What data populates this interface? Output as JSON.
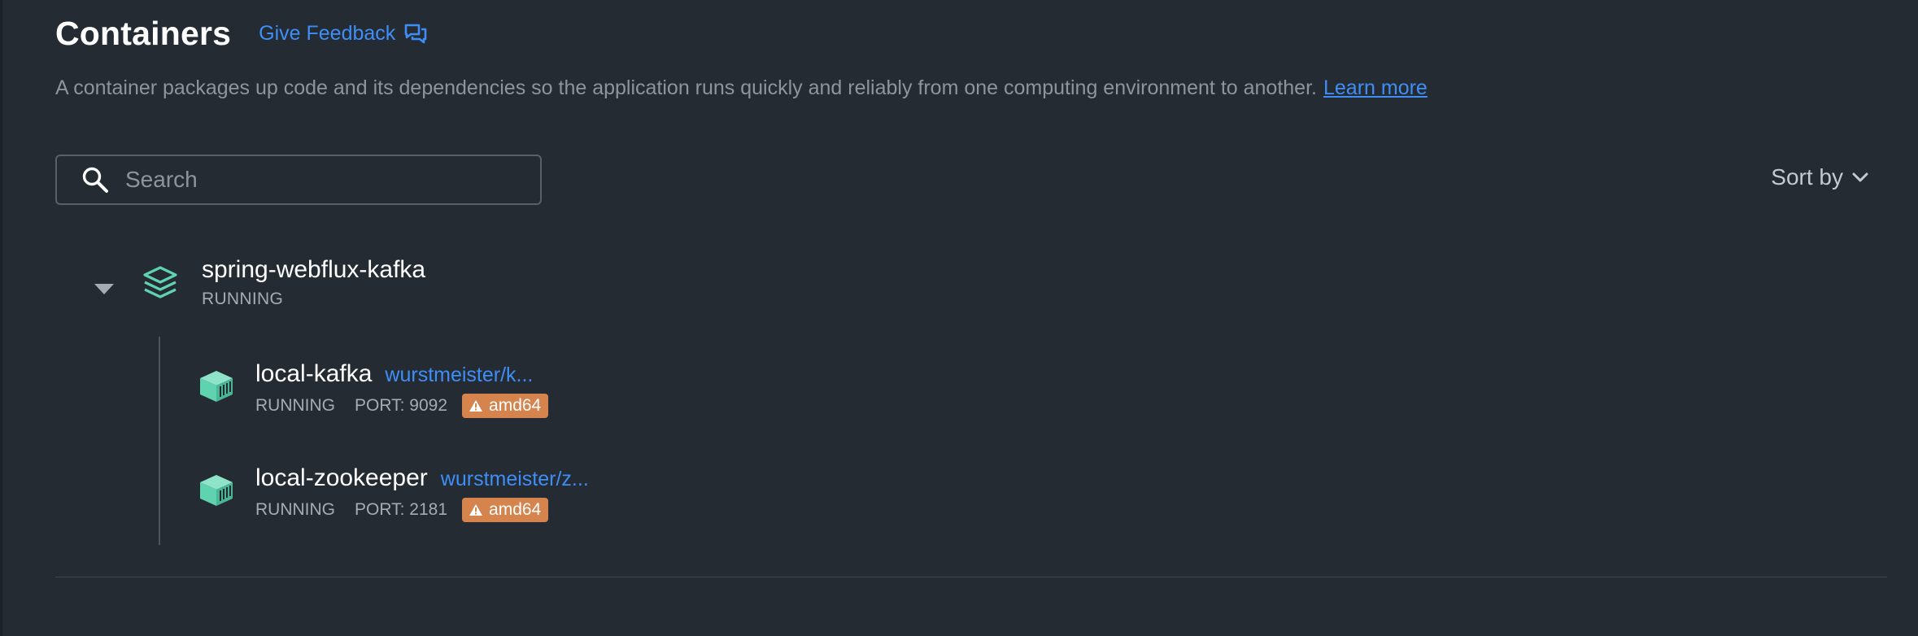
{
  "header": {
    "title": "Containers",
    "feedback_label": "Give Feedback",
    "feedback_icon": "chat-bubbles-icon"
  },
  "description": {
    "text": "A container packages up code and its dependencies so the application runs quickly and reliably from one computing environment to another.",
    "link_label": "Learn more"
  },
  "search": {
    "placeholder": "Search",
    "value": "",
    "icon": "search-icon"
  },
  "sort": {
    "label": "Sort by",
    "icon": "chevron-down-icon"
  },
  "group": {
    "name": "spring-webflux-kafka",
    "status": "RUNNING",
    "icon": "stack-layers-icon",
    "expanded": true,
    "containers": [
      {
        "name": "local-kafka",
        "image": "wurstmeister/k...",
        "status": "RUNNING",
        "port": "PORT: 9092",
        "badge": "amd64",
        "icon": "container-box-icon"
      },
      {
        "name": "local-zookeeper",
        "image": "wurstmeister/z...",
        "status": "RUNNING",
        "port": "PORT: 2181",
        "badge": "amd64",
        "icon": "container-box-icon"
      }
    ]
  },
  "colors": {
    "background": "#252b33",
    "accent_link": "#3e8ef7",
    "container_icon": "#5fd2b0",
    "warning_badge": "#d5844e",
    "muted_text": "#8d949c"
  }
}
